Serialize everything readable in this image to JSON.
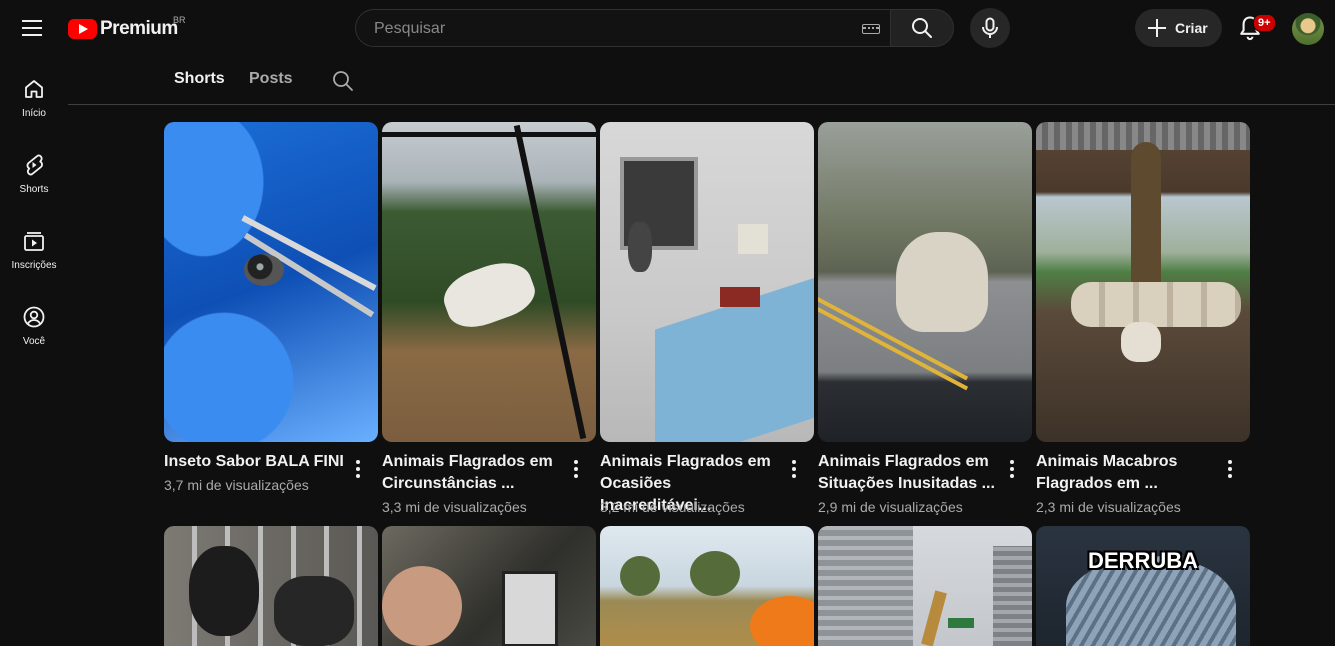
{
  "app": {
    "logo_text": "Premium",
    "region": "BR"
  },
  "search": {
    "placeholder": "Pesquisar"
  },
  "header": {
    "create_label": "Criar",
    "notifications_badge": "9+"
  },
  "sidebar": {
    "items": [
      {
        "label": "Início",
        "icon": "home-icon"
      },
      {
        "label": "Shorts",
        "icon": "shorts-icon"
      },
      {
        "label": "Inscrições",
        "icon": "subscriptions-icon"
      },
      {
        "label": "Você",
        "icon": "you-icon"
      }
    ]
  },
  "tabs": [
    {
      "label": "Shorts",
      "active": true
    },
    {
      "label": "Posts",
      "active": false
    }
  ],
  "shorts": [
    {
      "title_line1": "Inseto Sabor BALA FINI",
      "title_line2": "",
      "views": "3,7 mi de visualizações"
    },
    {
      "title_line1": "Animais Flagrados em",
      "title_line2": "Circunstâncias ...",
      "views": "3,3 mi de visualizações"
    },
    {
      "title_line1": "Animais Flagrados em",
      "title_line2": "Ocasiões Inacreditávei...",
      "views": "3,2 mi de visualizações"
    },
    {
      "title_line1": "Animais Flagrados em",
      "title_line2": "Situações Inusitadas ...",
      "views": "2,9 mi de visualizações"
    },
    {
      "title_line1": "Animais Macabros",
      "title_line2": "Flagrados em ...",
      "views": "2,3 mi de visualizações"
    }
  ],
  "row2": {
    "thumb5_caption": "DERRUBA"
  },
  "colors": {
    "background": "#0f0f0f",
    "brand_red": "#ff0000",
    "badge_red": "#cc0000",
    "text_primary": "#f1f1f1",
    "text_secondary": "#aaaaaa"
  }
}
